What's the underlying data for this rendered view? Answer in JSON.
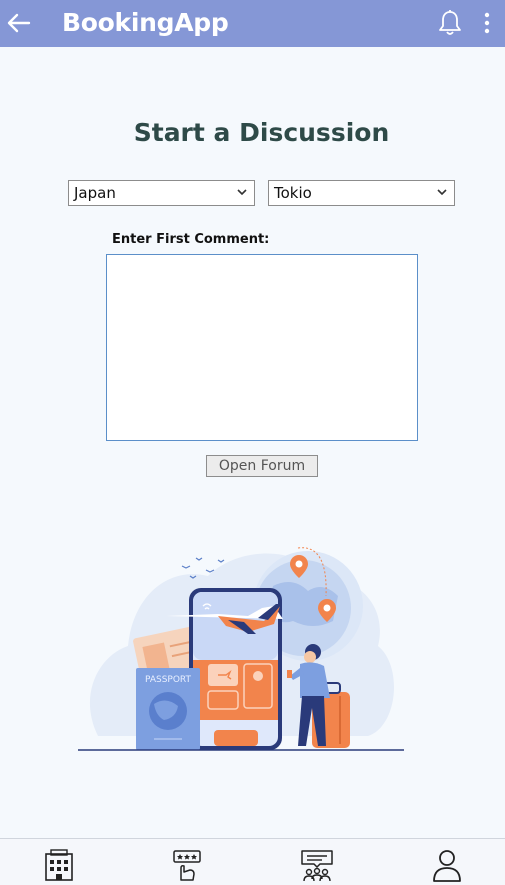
{
  "app_bar": {
    "title": "BookingApp",
    "icons": [
      "back-arrow-icon",
      "bell-icon",
      "more-vertical-icon"
    ]
  },
  "page": {
    "heading": "Start a Discussion"
  },
  "filters": {
    "country_value": "Japan",
    "city_value": "Tokio"
  },
  "comment": {
    "label": "Enter First Comment:",
    "value": ""
  },
  "actions": {
    "open_forum_label": "Open Forum"
  },
  "illustration": {
    "passport_text": "PASSPORT",
    "accent_color": "#f2844c",
    "primary_color": "#6b8fd6"
  },
  "bottom_nav": {
    "items": [
      "hotel-icon",
      "rating-icon",
      "forum-icon",
      "profile-icon"
    ]
  },
  "colors": {
    "app_bar": "#8597d6",
    "heading": "#2e4a48",
    "background": "#f5f9fd"
  }
}
